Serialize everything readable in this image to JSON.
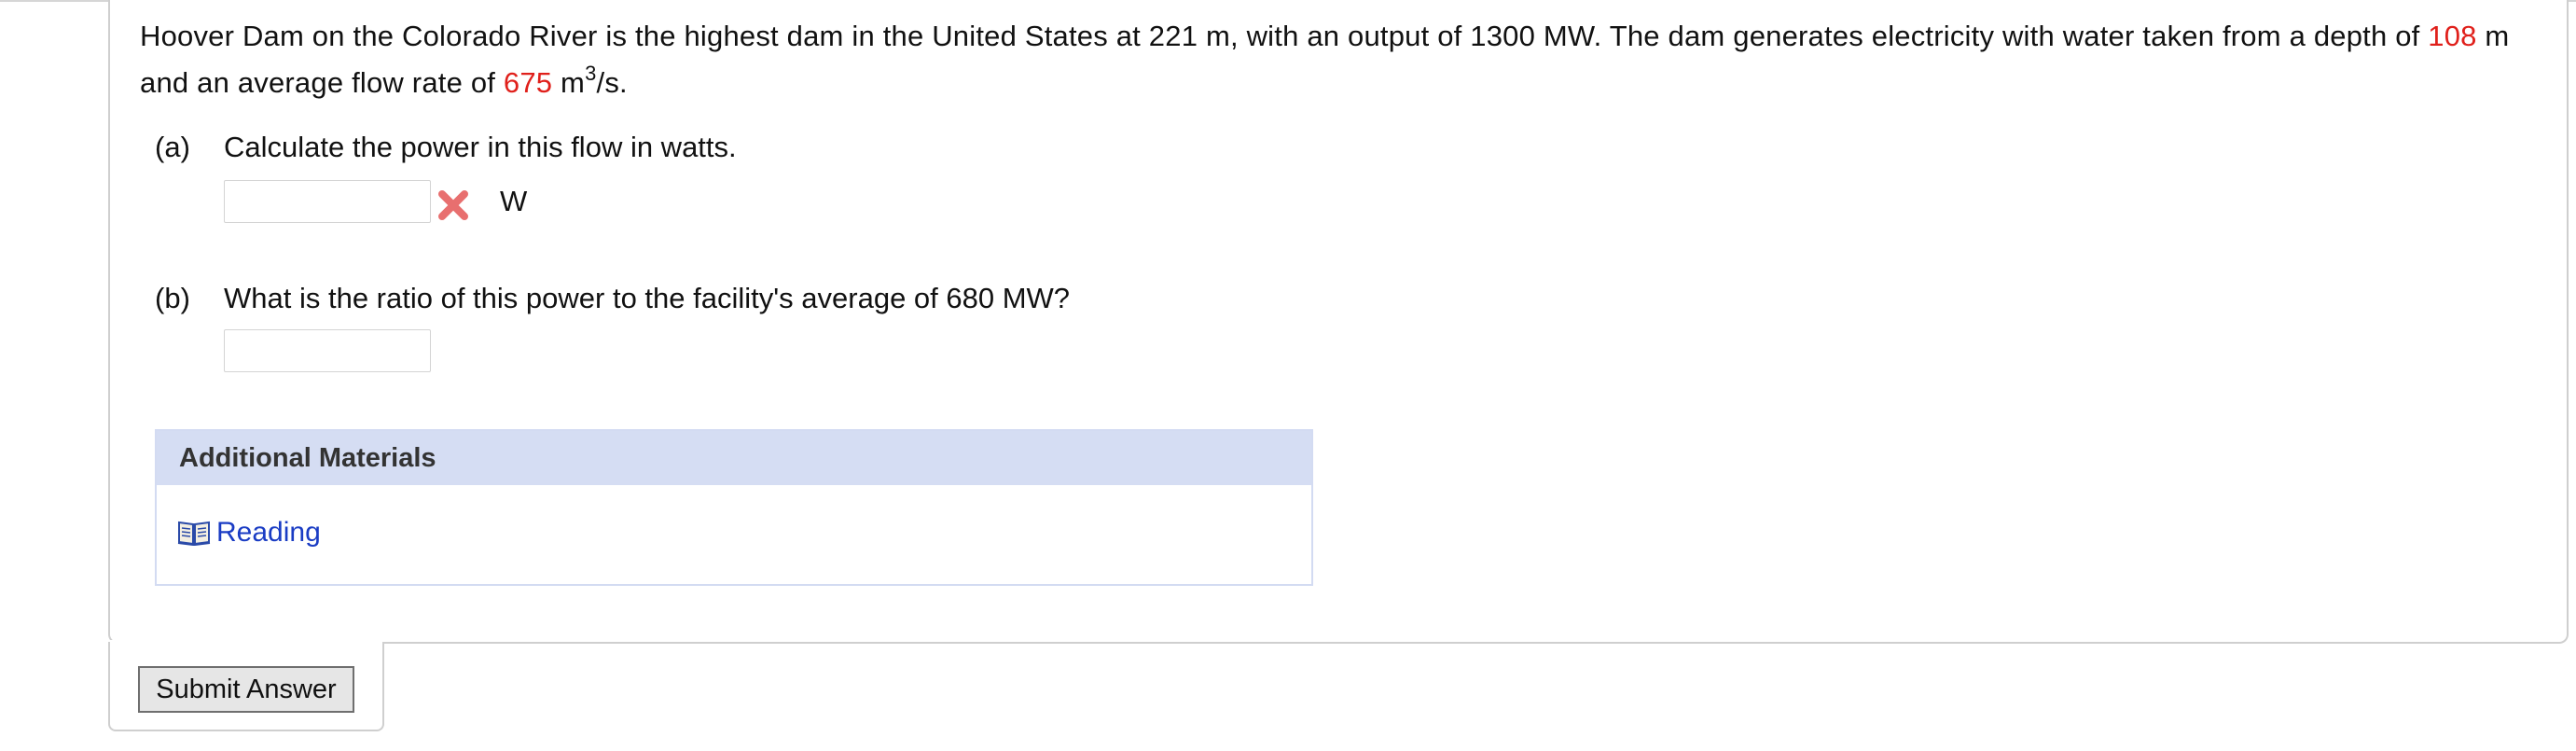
{
  "question": {
    "text_1": "Hoover Dam on the Colorado River is the highest dam in the United States at 221 m, with an output of 1300 MW. The dam generates electricity with water taken from a depth of ",
    "depth_value": "108",
    "text_2": " m and an average flow rate of ",
    "flow_value": "675",
    "text_3": " m",
    "exponent": "3",
    "text_4": "/s."
  },
  "parts": [
    {
      "letter": "(a)",
      "prompt": "Calculate the power in this flow in watts.",
      "answer_value": "",
      "status": "incorrect",
      "unit": "W"
    },
    {
      "letter": "(b)",
      "prompt": "What is the ratio of this power to the facility's average of 680 MW?",
      "answer_value": ""
    }
  ],
  "materials": {
    "header": "Additional Materials",
    "link_label": "Reading",
    "link_icon": "book-icon"
  },
  "submit": {
    "label": "Submit Answer"
  },
  "colors": {
    "highlight_red": "#e0201b",
    "materials_header_bg": "#d5ddf3",
    "link_blue": "#1a3cc4",
    "wrong_mark": "#e86f6f"
  }
}
